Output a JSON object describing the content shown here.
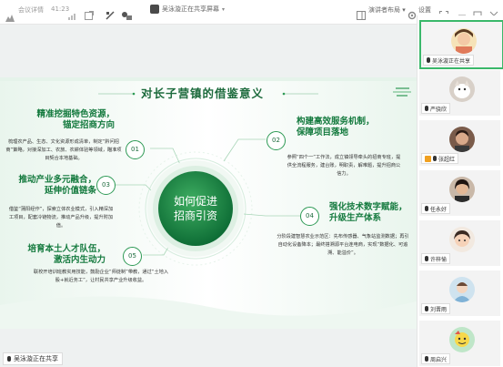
{
  "topbar": {
    "meeting_id": "会议详情",
    "signal": "41:23",
    "share_status": "吴泳漩正在共享屏幕",
    "view_layout": "演讲者布局",
    "settings": "设置"
  },
  "slide": {
    "title": "对长子营镇的借鉴意义",
    "center_line1": "如何促进",
    "center_line2": "招商引资",
    "sections": [
      {
        "num": "01",
        "heading": "精准挖掘特色资源，锚定招商方向",
        "heading_l1": "精准挖掘特色资源，",
        "heading_l2": "锚定招商方向",
        "body": "梳理农产品、生态、文化资源形成清单，制定“黔问招商”策略，对接深加工、农旅、农耕体验等领域，瞄准项目契合本地基础。"
      },
      {
        "num": "02",
        "heading": "构建高效服务机制，保障项目落地",
        "heading_l1": "构建高效服务机制，",
        "heading_l2": "保障项目落地",
        "body": "参照“四个一”工作法，成立镇领导牵头的招商专班，提供全流程服务，建台账，明职责，解难题，提升招商公信力。"
      },
      {
        "num": "03",
        "heading": "推动产业多元融合，延伸价值链条",
        "heading_l1": "推动产业多元融合，",
        "heading_l2": "延伸价值链条",
        "body": "借鉴“蒲阳经作”，探索立体农业模式，引入精深加工项目，配套冷链物流，推动产品升级，提升附加值。"
      },
      {
        "num": "04",
        "heading": "强化技术数字赋能，升级生产体系",
        "heading_l1": "强化技术数字赋能，",
        "heading_l2": "升级生产体系",
        "body": "分阶段建智慧农业示范区：先布传感器、气象站监测数据；再引自动化设备降本；最终搭溯源平台连电商，实现“数据化、可追溯、能溢价”。"
      },
      {
        "num": "05",
        "heading": "培育本土人才队伍，激活内生动力",
        "heading_l1": "培育本土人才队伍，",
        "heading_l2": "激活内生动力",
        "body": "联校开培训班教实用技能，鼓励企业“师徒制”带教，通过“土地入股+就近务工”，让村民共享产业升级收益。"
      }
    ]
  },
  "presenter": {
    "label": "吴泳漩正在共享"
  },
  "participants": [
    {
      "name": "吴泳漩正在共享",
      "active": true
    },
    {
      "name": "严骁欣",
      "active": false
    },
    {
      "name": "张超红",
      "active": false
    },
    {
      "name": "任永好",
      "active": false
    },
    {
      "name": "许梓愉",
      "active": false
    },
    {
      "name": "刘晋雨",
      "active": false
    },
    {
      "name": "周启兴",
      "active": false
    }
  ],
  "colors": {
    "accent": "#147a3e",
    "active_border": "#3ab86a"
  }
}
